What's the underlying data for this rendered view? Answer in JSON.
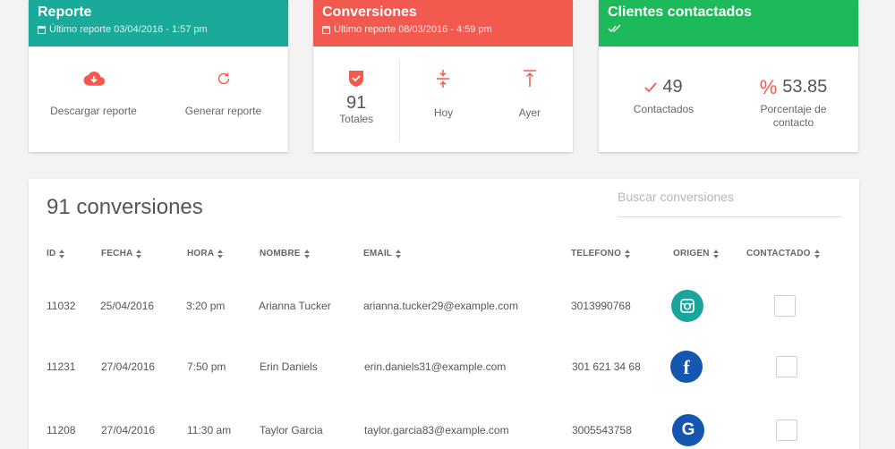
{
  "colors": {
    "teal": "#1aaa99",
    "red": "#f25a4f",
    "green": "#1dba5b",
    "instagram": "#1aa59c",
    "facebook": "#1556b0",
    "google": "#1556b0"
  },
  "cards": {
    "reporte": {
      "title": "Reporte",
      "subtitle": "Último reporte 03/04/2016 - 1:57 pm",
      "download_label": "Descargar reporte",
      "generate_label": "Generar reporte"
    },
    "conversiones": {
      "title": "Conversiones",
      "subtitle": "Último reporte 08/03/2016 - 4:59 pm",
      "totales_value": "91",
      "totales_label": "Totales",
      "hoy_label": "Hoy",
      "ayer_label": "Ayer"
    },
    "clientes": {
      "title": "Clientes contactados",
      "contactados_value": "49",
      "contactados_label": "Contactados",
      "porcentaje_value": "53.85",
      "porcentaje_label": "Porcentaje de contacto"
    }
  },
  "table": {
    "title": "91 conversiones",
    "search_placeholder": "Buscar conversiones",
    "headers": {
      "id": "ID",
      "fecha": "FECHA",
      "hora": "HORA",
      "nombre": "NOMBRE",
      "email": "EMAIL",
      "telefono": "TELEFONO",
      "origen": "ORIGEN",
      "contactado": "CONTACTADO"
    },
    "rows": [
      {
        "id": "11032",
        "fecha": "25/04/2016",
        "hora": "3:20 pm",
        "nombre": "Arianna Tucker",
        "email": "arianna.tucker29@example.com",
        "telefono": "3013990768",
        "origen": "instagram-icon",
        "contactado": false
      },
      {
        "id": "11231",
        "fecha": "27/04/2016",
        "hora": "7:50 pm",
        "nombre": "Erin Daniels",
        "email": "erin.daniels31@example.com",
        "telefono": "301 621 34 68",
        "origen": "facebook-icon",
        "contactado": false
      },
      {
        "id": "11208",
        "fecha": "27/04/2016",
        "hora": "11:30 am",
        "nombre": "Taylor Garcia",
        "email": "taylor.garcia83@example.com",
        "telefono": "3005543758",
        "origen": "google-icon",
        "contactado": false
      }
    ]
  }
}
